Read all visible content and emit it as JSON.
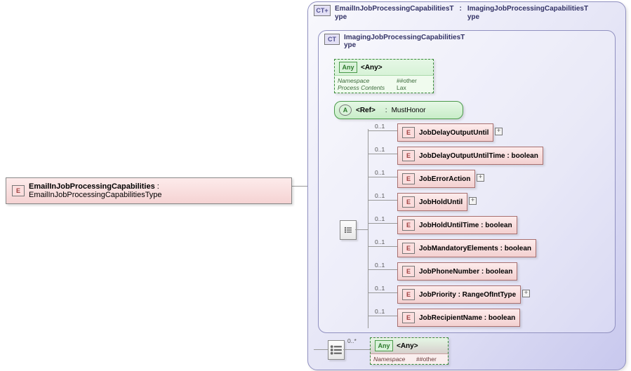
{
  "root": {
    "badge": "E",
    "name": "EmailInJobProcessingCapabilities",
    "type": "EmailInJobProcessingCapabilitiesType"
  },
  "outerCT": {
    "badge": "CT+",
    "name_l1": "EmailInJobProcessingCapabilitiesT",
    "name_l2": "ype",
    "base_l1": "ImagingJobProcessingCapabilitiesT",
    "base_l2": "ype"
  },
  "innerCT": {
    "badge": "CT",
    "name_l1": "ImagingJobProcessingCapabilitiesT",
    "name_l2": "ype"
  },
  "any1": {
    "label": "<Any>",
    "props": [
      {
        "k": "Namespace",
        "v": "##other"
      },
      {
        "k": "Process Contents",
        "v": "Lax"
      }
    ]
  },
  "ref": {
    "label": "<Ref>",
    "attr": "MustHonor"
  },
  "children": [
    {
      "card": "0..1",
      "name": "JobDelayOutputUntil",
      "type": "",
      "expand": true
    },
    {
      "card": "0..1",
      "name": "JobDelayOutputUntilTime",
      "type": "boolean",
      "expand": false
    },
    {
      "card": "0..1",
      "name": "JobErrorAction",
      "type": "",
      "expand": true
    },
    {
      "card": "0..1",
      "name": "JobHoldUntil",
      "type": "",
      "expand": true
    },
    {
      "card": "0..1",
      "name": "JobHoldUntilTime",
      "type": "boolean",
      "expand": false
    },
    {
      "card": "0..1",
      "name": "JobMandatoryElements",
      "type": "boolean",
      "expand": false
    },
    {
      "card": "0..1",
      "name": "JobPhoneNumber",
      "type": "boolean",
      "expand": false
    },
    {
      "card": "0..1",
      "name": "JobPriority",
      "type": "RangeOfIntType",
      "expand": true
    },
    {
      "card": "0..1",
      "name": "JobRecipientName",
      "type": "boolean",
      "expand": false
    }
  ],
  "outerSeq": {
    "card": "0..*"
  },
  "any2": {
    "label": "<Any>",
    "props": [
      {
        "k": "Namespace",
        "v": "##other"
      }
    ]
  },
  "chart_data": {
    "type": "diagram",
    "root": "EmailInJobProcessingCapabilities : EmailInJobProcessingCapabilitiesType",
    "complexType": "EmailInJobProcessingCapabilitiesType",
    "base": "ImagingJobProcessingCapabilitiesType",
    "attributes": [
      {
        "ref": "MustHonor"
      }
    ],
    "wildcards": [
      {
        "namespace": "##other",
        "processContents": "Lax",
        "scope": "inner"
      },
      {
        "namespace": "##other",
        "occurs": "0..*",
        "scope": "outer"
      }
    ],
    "elements": [
      {
        "name": "JobDelayOutputUntil",
        "occurs": "0..1"
      },
      {
        "name": "JobDelayOutputUntilTime",
        "type": "boolean",
        "occurs": "0..1"
      },
      {
        "name": "JobErrorAction",
        "occurs": "0..1"
      },
      {
        "name": "JobHoldUntil",
        "occurs": "0..1"
      },
      {
        "name": "JobHoldUntilTime",
        "type": "boolean",
        "occurs": "0..1"
      },
      {
        "name": "JobMandatoryElements",
        "type": "boolean",
        "occurs": "0..1"
      },
      {
        "name": "JobPhoneNumber",
        "type": "boolean",
        "occurs": "0..1"
      },
      {
        "name": "JobPriority",
        "type": "RangeOfIntType",
        "occurs": "0..1"
      },
      {
        "name": "JobRecipientName",
        "type": "boolean",
        "occurs": "0..1"
      }
    ]
  }
}
